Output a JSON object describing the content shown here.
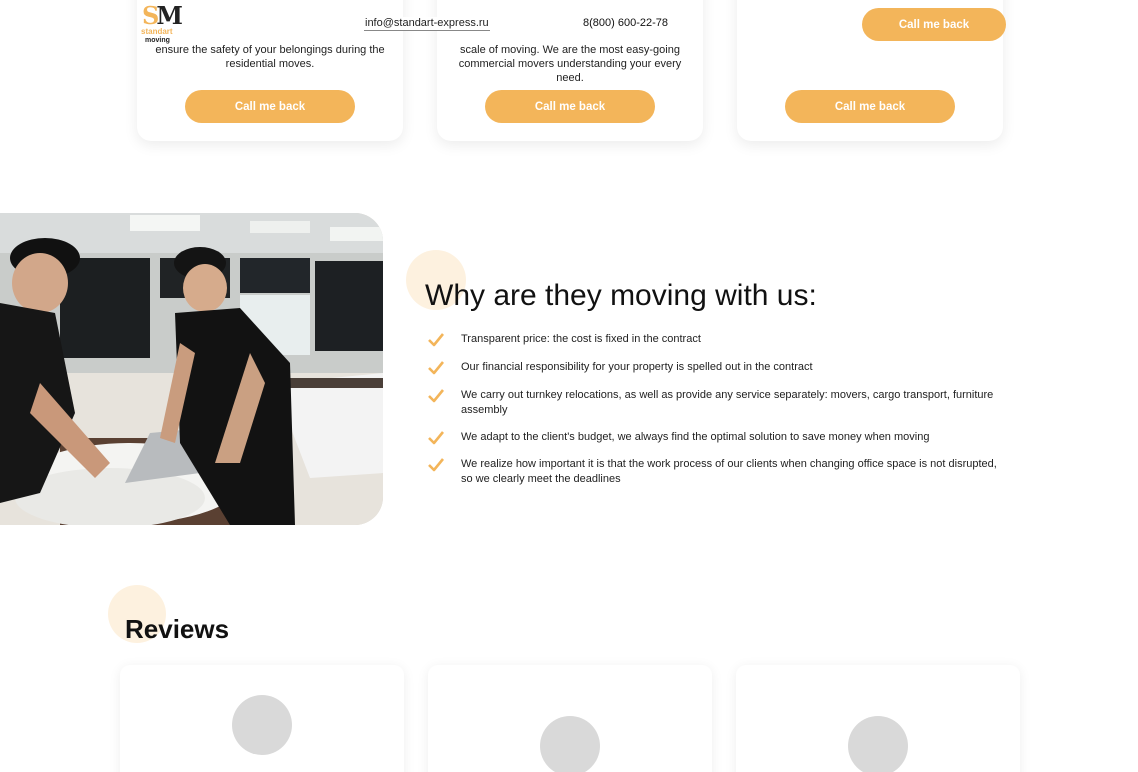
{
  "header": {
    "logo_letters": "SM",
    "logo_line1": "standart",
    "logo_line2": "moving",
    "email": "info@standart-express.ru",
    "phone": "8(800) 600-22-78",
    "cta_label": "Call me back"
  },
  "service_cards": [
    {
      "text": "ensure the safety of your belongings during the residential moves.",
      "button_label": "Call me back"
    },
    {
      "text": "scale of moving. We are the most easy-going commercial movers understanding your every need.",
      "button_label": "Call me back"
    },
    {
      "text": "",
      "button_label": "Call me back"
    }
  ],
  "why": {
    "title": "Why are they moving with us:",
    "items": [
      "Transparent price: the cost is fixed in the contract",
      "Our financial responsibility for your property is spelled out in the contract",
      "We carry out turnkey relocations, as well as provide any service separately: movers, cargo transport, furniture assembly",
      "We adapt to the client's budget, we always find the optimal solution to save money when moving",
      "We realize how important it is that the work process of our clients when changing office space is not disrupted, so we clearly meet the deadlines"
    ]
  },
  "reviews": {
    "title": "Reviews"
  },
  "colors": {
    "accent": "#f3b55a",
    "accent_light": "#fdf1df",
    "avatar_placeholder": "#d9d9d9"
  }
}
